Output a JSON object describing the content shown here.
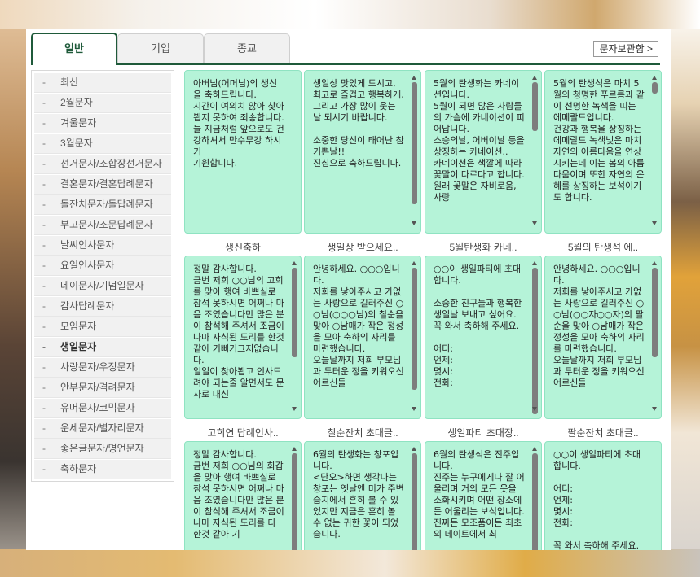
{
  "tabs": [
    {
      "label": "일반",
      "active": true
    },
    {
      "label": "기업",
      "active": false
    },
    {
      "label": "종교",
      "active": false
    }
  ],
  "archive_button": "문자보관함 >",
  "sidebar": {
    "items": [
      {
        "label": "최신",
        "active": false
      },
      {
        "label": "2월문자",
        "active": false
      },
      {
        "label": "겨울문자",
        "active": false
      },
      {
        "label": "3월문자",
        "active": false
      },
      {
        "label": "선거문자/조합장선거문자",
        "active": false
      },
      {
        "label": "결혼문자/결혼답례문자",
        "active": false
      },
      {
        "label": "돌잔치문자/돌답례문자",
        "active": false
      },
      {
        "label": "부고문자/조문답례문자",
        "active": false
      },
      {
        "label": "날씨인사문자",
        "active": false
      },
      {
        "label": "요일인사문자",
        "active": false
      },
      {
        "label": "데이문자/기념일문자",
        "active": false
      },
      {
        "label": "감사답례문자",
        "active": false
      },
      {
        "label": "모임문자",
        "active": false
      },
      {
        "label": "생일문자",
        "active": true
      },
      {
        "label": "사랑문자/우정문자",
        "active": false
      },
      {
        "label": "안부문자/격려문자",
        "active": false
      },
      {
        "label": "유머문자/코믹문자",
        "active": false
      },
      {
        "label": "운세문자/별자리문자",
        "active": false
      },
      {
        "label": "좋은글문자/명언문자",
        "active": false
      },
      {
        "label": "축하문자",
        "active": false
      }
    ]
  },
  "messages": [
    {
      "text": "아버님(어머님)의 생신을 축하드립니다.\n시간이 여의치 않아 찾아 뵙지 못하여 죄송합니다.\n늘 지금처럼 앞으로도 건강하셔서 만수무강 하시기\n기원합니다.",
      "caption": "생신축하",
      "scrollbar": false
    },
    {
      "text": "생일상 맛있게 드시고, 최고로 즐겁고 행복하게, 그리고 가장 많이 웃는 날 되시기 바랍니다.\n\n소중한 당신이 태어난 참 기쁜날!!\n진심으로 축하드립니다.",
      "caption": "생일상 받으세요..",
      "scrollbar": true
    },
    {
      "text": "5월의 탄생화는 카네이션입니다.\n5월이 되면 많은 사람들의 가슴에 카네이션이 피어납니다.\n스승의날, 어버이날 등을 상징하는 카네이션..\n카네이션은 색깔에 따라 꽃말이 다르다고 합니다.\n원래 꽃말은 자비로움, 사랑",
      "caption": "5월탄생화 카네..",
      "scrollbar": true
    },
    {
      "text": "5월의 탄생석은 마치 5월의 청명한 푸르름과 같이 선명한 녹색을 띠는 에메랄드입니다.\n건강과 행복을 상징하는 에메랄드 녹색빛은 마치 자연의 아름다움을 연상시키는데 이는 봄의 아름다움이며 또한 자연의 은혜를 상징하는 보석이기도 합니다.",
      "caption": "5월의 탄생석 에..",
      "scrollbar": true
    },
    {
      "text": "정말 감사합니다.\n금번 저희 ○○님의 고희를 맞아 행여 바쁘실로 참석 못하시면 어쩌나 마음 조였습니다만 많은 분이 참석해 주셔서 조금이나마 자식된 도리를 한것 같아 기뻐기그지없습니다.\n일일이 찾아뵙고 인사드려야 되는줄 알면서도 문자로 대신",
      "caption": "고희연 답례인사..",
      "scrollbar": true
    },
    {
      "text": "안녕하세요. ○○○입니다.\n저희를 낳아주시고 가없는 사랑으로 길러주신 ○○님(○○○님)의 칠순을 맞아 ○남매가 작은 정성을 모아 축하의 자리를 마련했습니다.\n오늘날까지 저희 부모님과 두터운 정을 키워오신 어르신들",
      "caption": "칠순잔치 초대글..",
      "scrollbar": true
    },
    {
      "text": "○○이 생일파티에 초대합니다.\n\n소중한 친구들과 행복한 생일날 보내고 싶어요.\n꼭 와서 축하해 주세요.\n\n어디:\n언제:\n몇시:\n전화:",
      "caption": "생일파티 초대장..",
      "scrollbar": true
    },
    {
      "text": "안녕하세요. ○○○입니다.\n저희를 낳아주시고 가없는 사랑으로 길러주신 ○○님(○○자○○자)의 팔순을 맞아 ○남매가 작은 정성을 모아 축하의 자리를 마련했습니다.\n오늘날까지 저희 부모님과 두터운 정을 키워오신 어르신들",
      "caption": "팔순잔치 초대글..",
      "scrollbar": true
    },
    {
      "text": "정말 감사합니다.\n금번 저희 ○○님의 회갑을 맞아 행여 바쁘실로 참석 못하시면 어쩌나 마음 조였습니다만 많은 분이 참석해 주셔서 조금이나마 자식된 도리를 다 한것 같아 기",
      "caption": "",
      "scrollbar": true
    },
    {
      "text": "6월의 탄생화는 창포입니다.\n<단오>하면 생각나는 창포는 옛날엔 미가 주변 습지에서 흔히 볼 수 있었지만 지금은 흔히 볼 수 없는 귀한 꽃이 되었습니다.",
      "caption": "",
      "scrollbar": true
    },
    {
      "text": "6월의 탄생석은 진주입니다.\n진주는 누구에게나 잘 어울리며 거의 모든 옷을 소화시키며 어떤 장소에든 어울리는 보석입니다. 진짜든 모조품이든 최초의 데이트에서 최",
      "caption": "",
      "scrollbar": true
    },
    {
      "text": "○○이 생일파티에 초대합니다.\n\n어디:\n언제:\n몇시:\n전화:\n\n꼭 와서 축하해 주세요.",
      "caption": "",
      "scrollbar": false
    }
  ],
  "colors": {
    "accent": "#1f5a3a",
    "card_bg": "#b5f3d8",
    "card_border": "#8fe3c2"
  }
}
